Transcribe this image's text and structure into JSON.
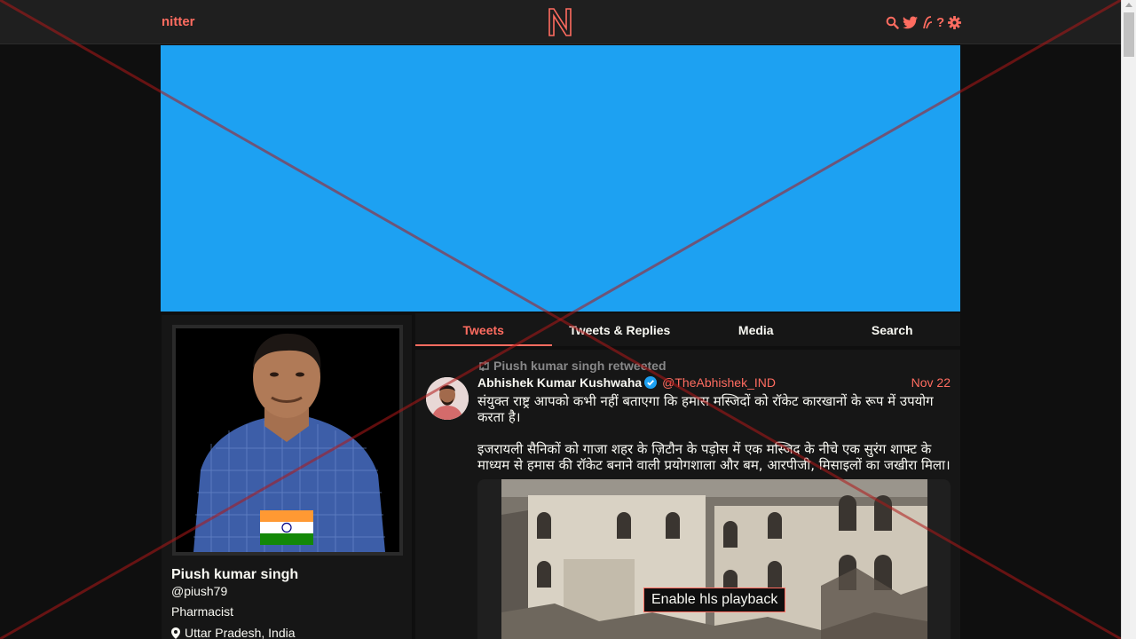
{
  "navbar": {
    "brand": "nitter",
    "logo_letter": "N",
    "icons": [
      "search-icon",
      "twitter-bird-icon",
      "rss-icon",
      "info-icon",
      "settings-gear-icon"
    ]
  },
  "profile": {
    "fullname": "Piush kumar singh",
    "username": "@piush79",
    "bio": "Pharmacist",
    "location": "Uttar Pradesh, India"
  },
  "tabs": [
    {
      "label": "Tweets",
      "active": true
    },
    {
      "label": "Tweets & Replies",
      "active": false
    },
    {
      "label": "Media",
      "active": false
    },
    {
      "label": "Search",
      "active": false
    }
  ],
  "tweet": {
    "retweet_header": "Piush kumar singh retweeted",
    "fullname": "Abhishek Kumar Kushwaha",
    "username": "@TheAbhishek_IND",
    "date": "Nov 22",
    "paragraph1": "संयुक्त राष्ट्र आपको कभी नहीं बताएगा कि हमास मस्जिदों को रॉकेट कारखानों के रूप में उपयोग करता है।",
    "paragraph2": "इजरायली सैनिकों को गाजा शहर के ज़िटौन के पड़ोस में एक मस्जिद के नीचे एक सुरंग शाफ्ट के माध्यम से हमास की रॉकेट बनाने वाली प्रयोगशाला और बम, आरपीजी, मिसाइलों का जखीरा मिला।",
    "video_button": "Enable hls playback"
  },
  "colors": {
    "accent": "#ff6c60",
    "background": "#0f0f0f",
    "panel": "#161616",
    "banner": "#1da1f2",
    "verified": "#1da1f2"
  }
}
